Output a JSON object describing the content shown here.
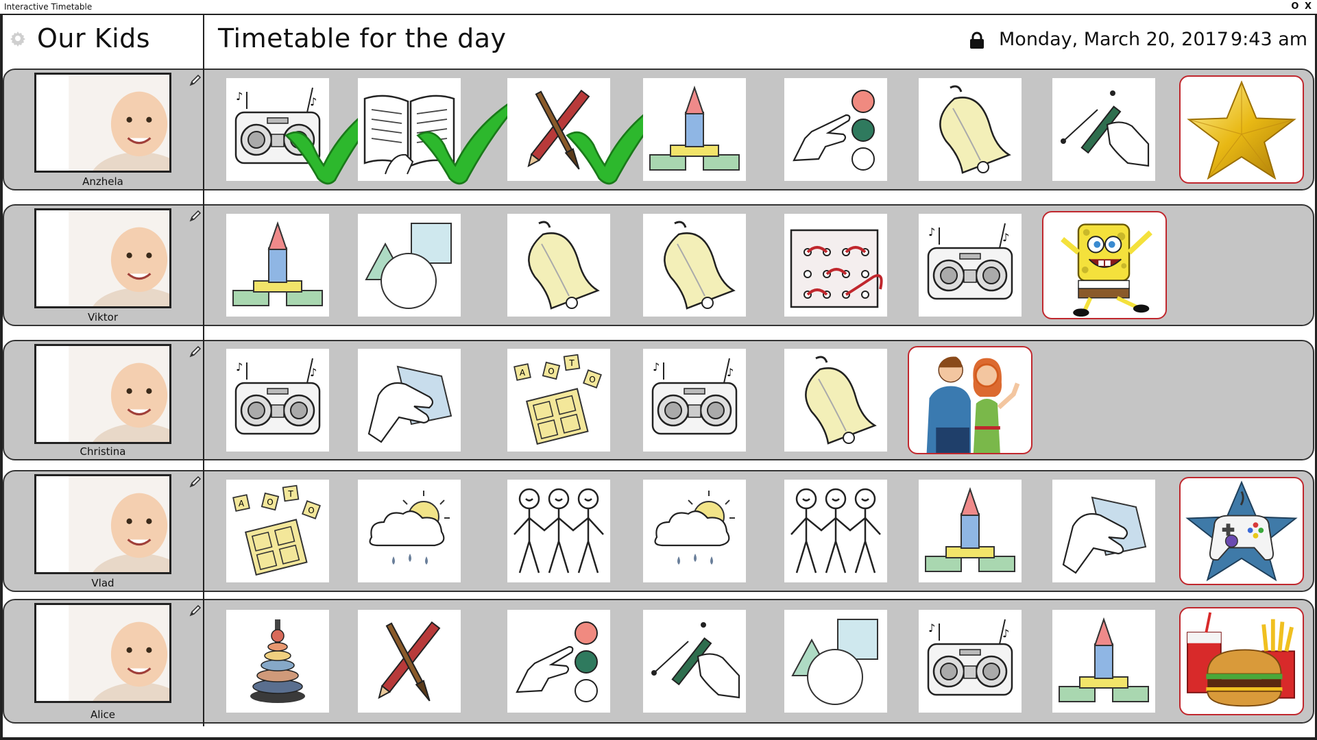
{
  "window": {
    "title": "Interactive Timetable",
    "controls": "O X"
  },
  "sidebar": {
    "title": "Our Kids"
  },
  "header": {
    "title": "Timetable for the day",
    "date": "Monday, March 20, 2017",
    "time": "9:43 am"
  },
  "kids": [
    {
      "name": "Anzhela",
      "activities": [
        "radio",
        "book",
        "paint",
        "tower",
        "dots",
        "bell",
        "draw"
      ],
      "completed": [
        true,
        true,
        true,
        false,
        false,
        false,
        false
      ],
      "reward": "star-gold"
    },
    {
      "name": "Viktor",
      "activities": [
        "tower",
        "shapes",
        "bell",
        "bell",
        "lacing",
        "radio"
      ],
      "completed": [
        false,
        false,
        false,
        false,
        false,
        false
      ],
      "reward": "spongebob"
    },
    {
      "name": "Christina",
      "activities": [
        "radio",
        "wipe",
        "letters",
        "radio",
        "bell"
      ],
      "completed": [
        false,
        false,
        false,
        false,
        false
      ],
      "reward": "parents"
    },
    {
      "name": "Vlad",
      "activities": [
        "letters",
        "weather",
        "people",
        "weather",
        "people",
        "tower",
        "wipe"
      ],
      "completed": [
        false,
        false,
        false,
        false,
        false,
        false,
        false
      ],
      "reward": "gamepad-star"
    },
    {
      "name": "Alice",
      "activities": [
        "pyramid",
        "paint",
        "dots",
        "draw",
        "shapes",
        "radio",
        "tower"
      ],
      "completed": [
        false,
        false,
        false,
        false,
        false,
        false,
        false
      ],
      "reward": "fastfood"
    }
  ],
  "colors": {
    "row_bg": "#c5c5c5",
    "reward_border": "#c0272d",
    "check_green": "#2db82d"
  }
}
